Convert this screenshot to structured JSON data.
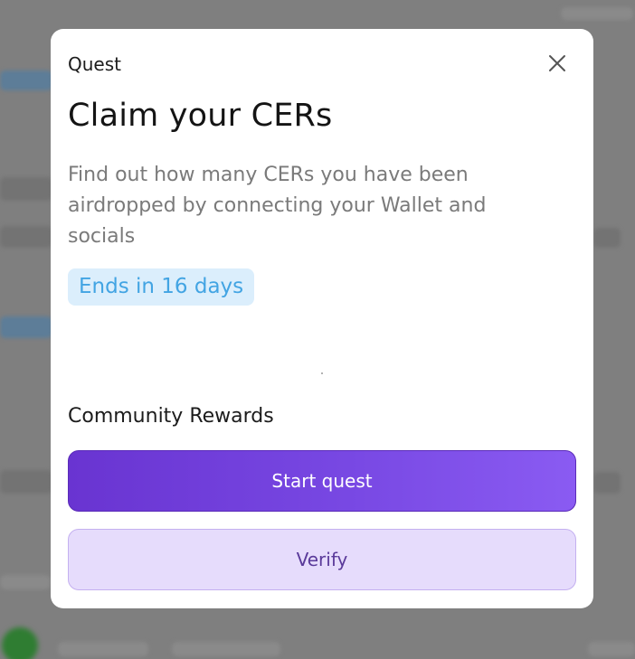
{
  "modal": {
    "header": "Quest",
    "close_icon": "close-icon",
    "title": "Claim your CERs",
    "description": "Find out how many CERs you have been airdropped by connecting your Wallet and socials",
    "badge": "Ends in 16 days",
    "section_label": "Community Rewards",
    "primary_button": "Start quest",
    "secondary_button": "Verify"
  },
  "colors": {
    "primary_gradient_start": "#6934d1",
    "primary_gradient_end": "#8a5bf2",
    "secondary_bg": "#e6dcfc",
    "badge_bg": "#dbeefc",
    "badge_text": "#42a4e3",
    "overlay": "#7f7f7f"
  }
}
